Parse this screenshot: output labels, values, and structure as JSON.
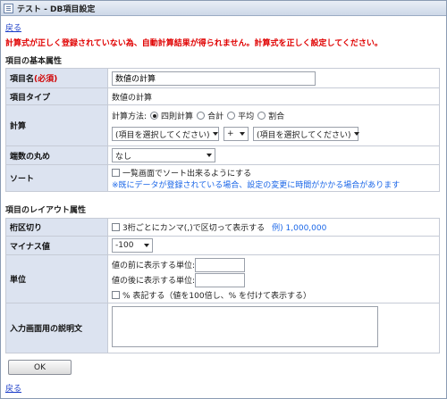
{
  "window": {
    "title": "テスト - DB項目設定"
  },
  "nav": {
    "back_label": "戻る"
  },
  "error_message": "計算式が正しく登録されていない為、自動計算結果が得られません。計算式を正しく設定してください。",
  "basic_section": {
    "title": "項目の基本属性",
    "item_name": {
      "label": "項目名",
      "required": "(必須)",
      "value": "数値の計算"
    },
    "item_type": {
      "label": "項目タイプ",
      "value": "数値の計算"
    },
    "calculation": {
      "label": "計算",
      "method_label": "計算方法:",
      "methods": [
        "四則計算",
        "合計",
        "平均",
        "割合"
      ],
      "selected_method": "四則計算",
      "left_operand": "(項目を選択してください)",
      "operator": "+",
      "right_operand": "(項目を選択してください)"
    },
    "rounding": {
      "label": "端数の丸め",
      "value": "なし"
    },
    "sort": {
      "label": "ソート",
      "checkbox_label": "一覧画面でソート出来るようにする",
      "checked": false,
      "note": "※既にデータが登録されている場合、設定の変更に時間がかかる場合があります"
    }
  },
  "layout_section": {
    "title": "項目のレイアウト属性",
    "comma": {
      "label": "桁区切り",
      "checkbox_label": "3桁ごとにカンマ(,)で区切って表示する",
      "example": "例) 1,000,000",
      "checked": false
    },
    "negative": {
      "label": "マイナス値",
      "value": "-100"
    },
    "unit": {
      "label": "単位",
      "before_label": "値の前に表示する単位:",
      "before_value": "",
      "after_label": "値の後に表示する単位:",
      "after_value": "",
      "percent_label": "% 表記する（値を100倍し、% を付けて表示する）",
      "percent_checked": false
    },
    "description": {
      "label": "入力画面用の説明文",
      "value": ""
    }
  },
  "ok_button": "OK"
}
